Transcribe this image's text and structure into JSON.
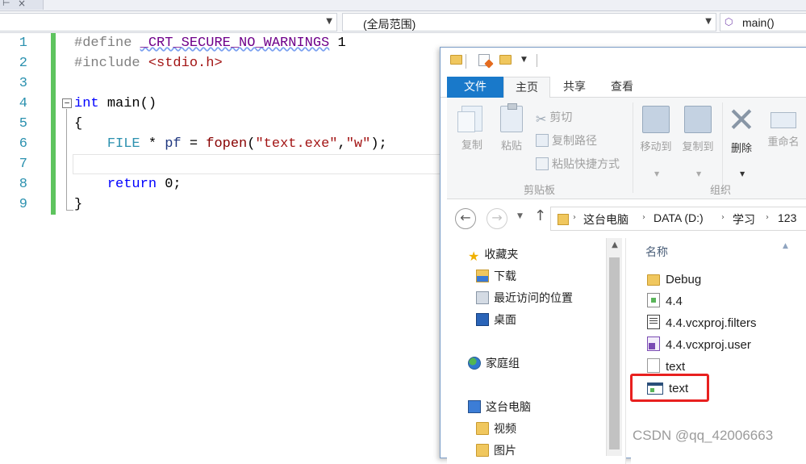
{
  "nav": {
    "file_combo": "",
    "scope_combo": "(全局范围)",
    "member_combo": "main()"
  },
  "editor": {
    "line_numbers": [
      "1",
      "2",
      "3",
      "4",
      "5",
      "6",
      "7",
      "8",
      "9"
    ],
    "lines": {
      "l1_directive": "#define",
      "l1_macro": "_CRT_SECURE_NO_WARNINGS",
      "l1_value": "1",
      "l2_directive": "#include",
      "l2_header": "<stdio.h>",
      "l4_type": "int",
      "l4_name": "main()",
      "l5_brace": "{",
      "l6_type": "FILE",
      "l6_op": "*",
      "l6_var": "pf",
      "l6_eq": "=",
      "l6_func": "fopen",
      "l6_open": "(",
      "l6_arg1": "\"text.exe\"",
      "l6_comma": ",",
      "l6_arg2": "\"w\"",
      "l6_close": ");",
      "l8_kw": "return",
      "l8_rest": "0;",
      "l9_brace": "}"
    }
  },
  "explorer": {
    "ribbon_tabs": {
      "file": "文件",
      "home": "主页",
      "share": "共享",
      "view": "查看"
    },
    "ribbon": {
      "copy": "复制",
      "paste": "粘贴",
      "cut": "剪切",
      "copy_path": "复制路径",
      "paste_shortcut": "粘贴快捷方式",
      "clipboard_group": "剪贴板",
      "move_to": "移动到",
      "copy_to": "复制到",
      "delete": "删除",
      "rename": "重命名",
      "organize_group": "组织"
    },
    "breadcrumb": [
      "这台电脑",
      "DATA (D:)",
      "学习",
      "123"
    ],
    "nav_pane": {
      "favorites": "收藏夹",
      "downloads": "下载",
      "recent": "最近访问的位置",
      "desktop": "桌面",
      "homegroup": "家庭组",
      "this_pc": "这台电脑",
      "videos": "视频",
      "pictures": "图片"
    },
    "column_name": "名称",
    "files": [
      {
        "name": "Debug",
        "icon": "folder-icon"
      },
      {
        "name": "4.4",
        "icon": "solution-file-icon"
      },
      {
        "name": "4.4.vcxproj.filters",
        "icon": "filters-file-icon"
      },
      {
        "name": "4.4.vcxproj.user",
        "icon": "vs-user-file-icon"
      },
      {
        "name": "text",
        "icon": "text-file-icon"
      },
      {
        "name": "text",
        "icon": "executable-file-icon"
      }
    ]
  },
  "watermark": "CSDN @qq_42006663",
  "colors": {
    "highlight": "#e8201f",
    "ribbon_file_tab": "#1979ca",
    "change_bar": "#5ec45e",
    "line_numbers": "#2b91af",
    "keyword": "#0000ff",
    "string": "#a31515"
  }
}
